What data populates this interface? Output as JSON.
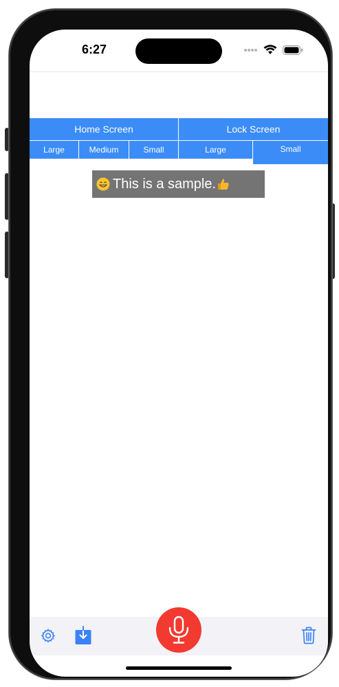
{
  "status_bar": {
    "time": "6:27",
    "icons": [
      "cellular-icon",
      "wifi-icon",
      "battery-icon"
    ]
  },
  "widget_tabs": {
    "groups": [
      {
        "label": "Home Screen",
        "sizes": [
          "Large",
          "Medium",
          "Small"
        ]
      },
      {
        "label": "Lock Screen",
        "sizes": [
          "Large",
          "Small"
        ]
      }
    ],
    "selected": {
      "group": "Lock Screen",
      "size": "Small"
    }
  },
  "preview": {
    "text": "This is a sample.",
    "leading_emoji": "grinning-face",
    "trailing_emoji": "thumbs-up"
  },
  "toolbar": {
    "icons": [
      "gear-icon",
      "download-icon",
      "microphone-icon",
      "trash-icon"
    ]
  },
  "colors": {
    "accent": "#3b8cf7",
    "record": "#f23a30",
    "preview_bg": "#747474",
    "toolbar_bg": "#f2f2f7"
  }
}
